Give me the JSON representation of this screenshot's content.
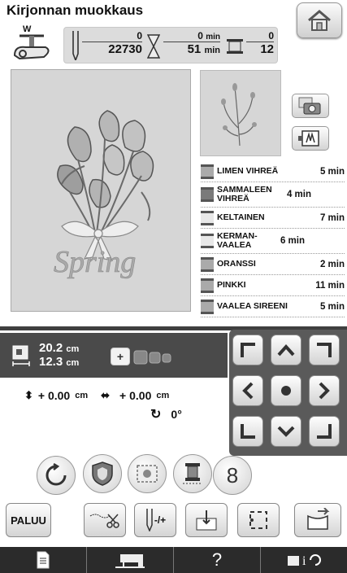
{
  "screen": {
    "title": "Kirjonnan muokkaus"
  },
  "counter": {
    "stitch_current": "0",
    "stitch_total": "22730",
    "time_current": "0",
    "time_current_unit": "min",
    "time_total": "51",
    "time_total_unit": "min",
    "color_current": "0",
    "color_total": "12"
  },
  "pattern": {
    "text": "Spring",
    "w_label": "W"
  },
  "colors": [
    {
      "name": "LIMEN VIHREÄ",
      "time": "5 min",
      "shade": "mid"
    },
    {
      "name": "SAMMALEEN VIHREÄ",
      "time": "4 min",
      "shade": "dark"
    },
    {
      "name": "KELTAINEN",
      "time": "7 min",
      "shade": "light"
    },
    {
      "name": "KERMAN-VAALEA",
      "time": "6 min",
      "shade": "light"
    },
    {
      "name": "ORANSSI",
      "time": "2 min",
      "shade": "mid"
    },
    {
      "name": "PINKKI",
      "time": "11 min",
      "shade": "mid"
    },
    {
      "name": "VAALEA SIREENI",
      "time": "5 min",
      "shade": "mid"
    }
  ],
  "size": {
    "height": "20.2",
    "width": "12.3",
    "unit": "cm"
  },
  "offset": {
    "vertical": "+ 0.00",
    "horizontal": "+ 0.00",
    "unit": "cm",
    "rotation": "0°"
  },
  "buttons": {
    "back": "PALUU",
    "needle_label": "-/+",
    "density_label": "8",
    "help": "?"
  },
  "icons": {
    "home": "home-icon",
    "camera": "camera-icon",
    "view": "view-icon"
  }
}
